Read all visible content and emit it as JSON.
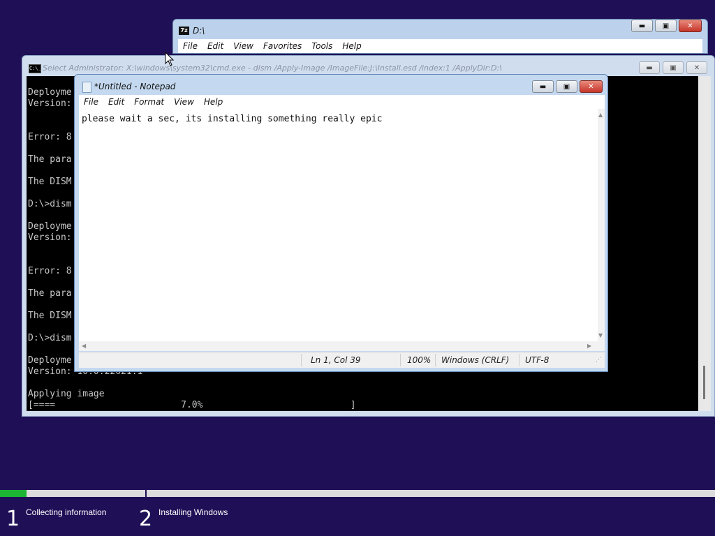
{
  "zip_window": {
    "title": "D:\\",
    "icon": "7z",
    "menu": [
      "File",
      "Edit",
      "View",
      "Favorites",
      "Tools",
      "Help"
    ]
  },
  "cmd_window": {
    "title": "Select Administrator: X:\\windows\\system32\\cmd.exe - dism  /Apply-Image /ImageFile:J:\\Install.esd /index:1 /ApplyDir:D:\\",
    "icon": "C:\\_",
    "lines": [
      "Deployme",
      "Version:",
      "Error: 8",
      "The para",
      "The DISM",
      "D:\\>dism",
      "Deployme",
      "Version:",
      "Error: 8",
      "The para",
      "The DISM",
      "D:\\>dism",
      "Deployme",
      "Version: 10.0.22621.1",
      "Applying image",
      "[====                       7.0%                           ]"
    ]
  },
  "notepad_window": {
    "title": "*Untitled - Notepad",
    "menu": [
      "File",
      "Edit",
      "Format",
      "View",
      "Help"
    ],
    "text": "please wait a sec, its installing something really epic",
    "status": {
      "position": "Ln 1, Col 39",
      "zoom": "100%",
      "line_ending": "Windows (CRLF)",
      "encoding": "UTF-8"
    }
  },
  "window_controls": {
    "minimize": "▬",
    "maximize": "▣",
    "close": "✕"
  },
  "setup": {
    "progress_fraction": 0.037,
    "colors": {
      "progress": "#1db534",
      "background": "#1f0f57"
    },
    "steps": [
      {
        "number": "1",
        "label": "Collecting information"
      },
      {
        "number": "2",
        "label": "Installing Windows"
      }
    ]
  }
}
